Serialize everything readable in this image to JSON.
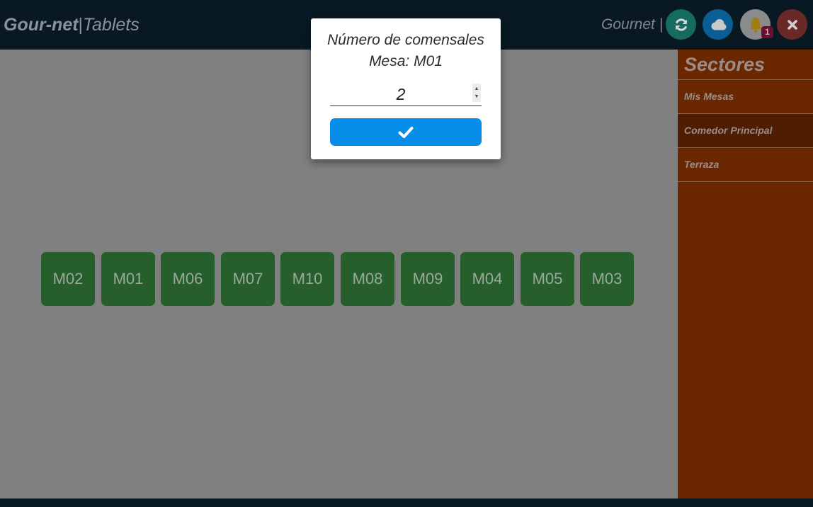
{
  "header": {
    "brand_bold": "Gour-net",
    "brand_sep": "|",
    "brand_light": "Tablets",
    "user_label": "Gournet |",
    "notification_count": "1",
    "buttons": [
      {
        "name": "refresh",
        "icon": "refresh-icon",
        "color": "#156b5f"
      },
      {
        "name": "cloud",
        "icon": "cloud-icon",
        "color": "#0b5e93"
      },
      {
        "name": "notifications",
        "icon": "bell-icon",
        "color": "#8b8b8b"
      },
      {
        "name": "close",
        "icon": "close-icon",
        "color": "#6b2828"
      }
    ]
  },
  "tables": [
    "M02",
    "M01",
    "M06",
    "M07",
    "M10",
    "M08",
    "M09",
    "M04",
    "M05",
    "M03"
  ],
  "sidebar": {
    "title": "Sectores",
    "items": [
      {
        "label": "Mis Mesas",
        "active": false
      },
      {
        "label": "Comedor Principal",
        "active": true
      },
      {
        "label": "Terraza",
        "active": false
      }
    ]
  },
  "modal": {
    "title": "Número de comensales",
    "subtitle": "Mesa: M01",
    "value": "2",
    "confirm_icon": "check-icon"
  },
  "colors": {
    "topbar": "#081924",
    "table": "#265f2b",
    "sidebar": "#6b2800",
    "sidebar_active": "#4f1d02",
    "confirm": "#088de8"
  }
}
